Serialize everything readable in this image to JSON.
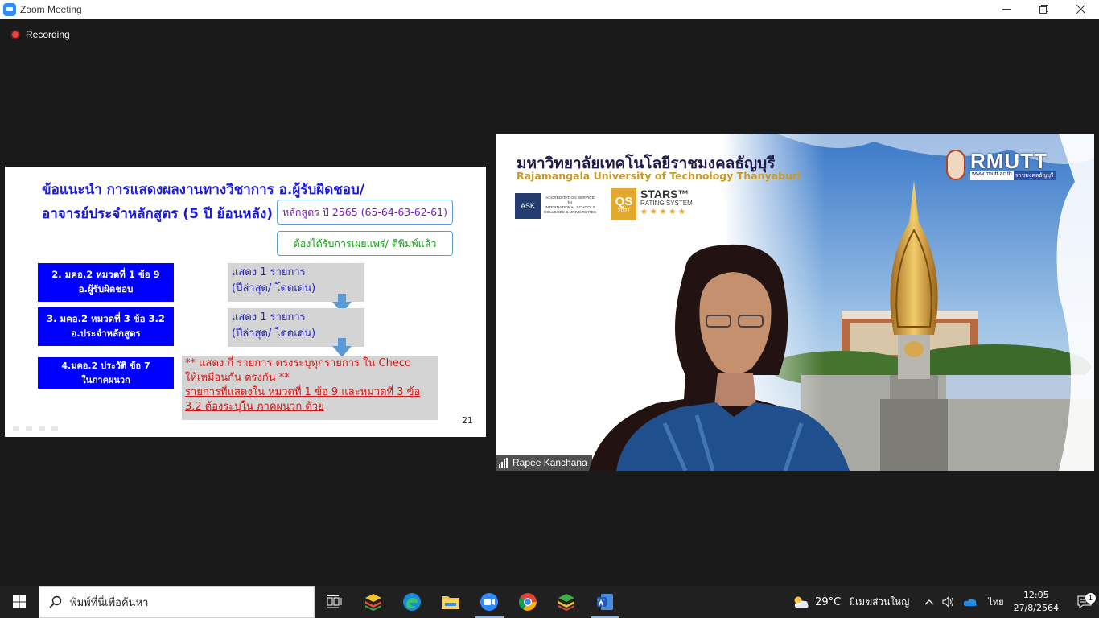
{
  "window": {
    "title": "Zoom Meeting",
    "minimize_icon": "minimize-icon",
    "restore_icon": "restore-icon",
    "close_icon": "close-icon"
  },
  "meeting": {
    "recording_label": "Recording",
    "participant_name": "Rapee Kanchana"
  },
  "slide": {
    "heading_line1": "ข้อแนะนำ การแสดงผลงานทางวิชาการ อ.ผู้รับผิดชอบ/",
    "heading_line2": "อาจารย์ประจำหลักสูตร (5 ปี ย้อนหลัง)",
    "course_box": "หลักสูตร ปี 2565 (65-64-63-62-61)",
    "published_box": "ต้องได้รับการเผยแพร่/ ตีพิมพ์แล้ว",
    "blue_boxes": [
      {
        "line1": "2. มคอ.2 หมวดที่  1 ข้อ 9",
        "line2": "อ.ผู้รับผิดชอบ"
      },
      {
        "line1": "3. มคอ.2 หมวดที่ 3 ข้อ 3.2",
        "line2": "อ.ประจำหลักสูตร"
      },
      {
        "line1": "4.มคอ.2 ประวัติ ข้อ 7",
        "line2": "ในภาคผนวก"
      }
    ],
    "grey_boxes": [
      {
        "line1": "แสดง 1 รายการ",
        "line2": "(ปีล่าสุด/ โดดเด่น)"
      },
      {
        "line1": "แสดง 1 รายการ",
        "line2": "(ปีล่าสุด/ โดดเด่น)"
      }
    ],
    "note_line1": "** แสดง กี่ รายการ ตรงระบุทุกรายการ ใน Checo",
    "note_line2": "ให้เหมือนกัน ตรงกัน **",
    "note_line3": "รายการที่แสดงใน หมวดที่ 1 ข้อ 9 และหมวดที่ 3 ข้อ",
    "note_line4": "3.2 ต้องระบุใน ภาคผนวก ด้วย",
    "page_number": "21"
  },
  "video_background": {
    "thai_name": "มหาวิทยาลัยเทคโนโลยีราชมงคลธัญบุรี",
    "english_name": "Rajamangala University of Technology Thanyaburi",
    "logo_text": "RMUTT",
    "website": "www.rmutt.ac.th",
    "website_thai": "ราชมงคลธัญบุรี",
    "ask_label": "ASK",
    "ask_text1": "ACCREDITATION SERVICE",
    "ask_text2": "for",
    "ask_text3": "INTERNATIONAL SCHOOLS",
    "ask_text4": "COLLEGES & UNIVERSITIES",
    "qs_label": "QS",
    "qs_year": "2021",
    "stars_title": "STARS™",
    "stars_sub": "RATING SYSTEM",
    "stars": "★ ★ ★ ★ ★"
  },
  "taskbar": {
    "search_placeholder": "พิมพ์ที่นี่เพื่อค้นหา",
    "apps": [
      "task-view",
      "bluestacks",
      "edge",
      "file-explorer",
      "zoom",
      "chrome",
      "bluestacks-2",
      "word"
    ],
    "temperature": "29°C",
    "weather_text": "มีเมฆส่วนใหญ่",
    "language": "ไทย",
    "time": "12:05",
    "date": "27/8/2564",
    "notification_count": "1"
  },
  "colors": {
    "heading_blue": "#1b1bd6",
    "box_blue": "#0000ff",
    "note_red": "#d11a1a",
    "recording_red": "#e6453b",
    "zoom_blue": "#2d8cff"
  }
}
